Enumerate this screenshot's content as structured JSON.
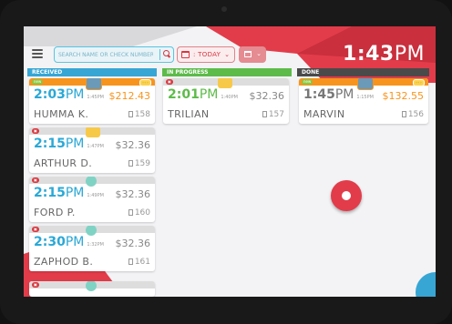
{
  "header": {
    "search_placeholder": "SEARCH NAME OR CHECK NUMBER",
    "date_filter_label": ": TODAY",
    "date_filter_chevron": "⌄",
    "picker_chevron": "⌄",
    "clock_time": "1:43",
    "clock_ampm": "PM"
  },
  "columns": {
    "received": {
      "title": "RECEIVED",
      "color": "#37a6d4"
    },
    "in_progress": {
      "title": "IN PROGRESS",
      "color": "#5dbb4a"
    },
    "done": {
      "title": "DONE",
      "color": "#4a4a4a"
    }
  },
  "orders": {
    "received": [
      {
        "time": "2:03",
        "ampm": "PM",
        "sub": "1:45PM",
        "price": "$212.43",
        "name": "HUMMA K.",
        "check": "158"
      },
      {
        "time": "2:15",
        "ampm": "PM",
        "sub": "1:47PM",
        "price": "$32.36",
        "name": "ARTHUR D.",
        "check": "159"
      },
      {
        "time": "2:15",
        "ampm": "PM",
        "sub": "1:49PM",
        "price": "$32.36",
        "name": "FORD P.",
        "check": "160"
      },
      {
        "time": "2:30",
        "ampm": "PM",
        "sub": "1:32PM",
        "price": "$32.36",
        "name": "ZAPHOD B.",
        "check": "161"
      }
    ],
    "in_progress": [
      {
        "time": "2:01",
        "ampm": "PM",
        "sub": "1:40PM",
        "price": "$32.36",
        "name": "TRILIAN",
        "check": "157"
      }
    ],
    "done": [
      {
        "time": "1:45",
        "ampm": "PM",
        "sub": "1:15PM",
        "price": "$132.55",
        "name": "MARVIN",
        "check": "156"
      }
    ]
  },
  "colors": {
    "accent_red": "#e23c4a",
    "received_blue": "#2aa8d6",
    "progress_green": "#5dbb4a",
    "price_orange": "#f7941d"
  },
  "icons": [
    "menu-icon",
    "search-icon",
    "calendar-icon",
    "chevron-down-icon",
    "receipt-icon",
    "vehicle-icon"
  ]
}
